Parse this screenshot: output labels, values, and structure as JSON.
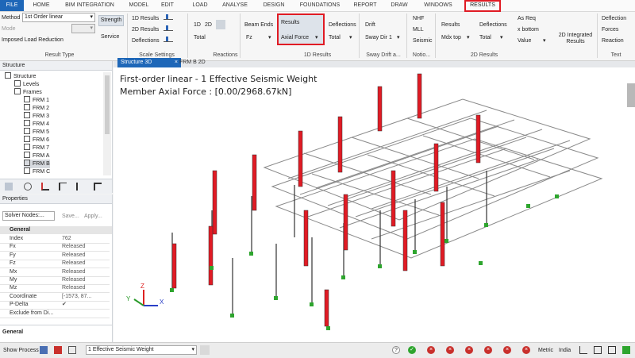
{
  "menu": {
    "items": [
      "FILE",
      "HOME",
      "BIM INTEGRATION",
      "MODEL",
      "EDIT",
      "LOAD",
      "ANALYSE",
      "DESIGN",
      "FOUNDATIONS",
      "REPORT",
      "DRAW",
      "WINDOWS",
      "RESULTS"
    ],
    "active": "RESULTS"
  },
  "ribbon": {
    "result_type": {
      "method_label": "Method",
      "method_value": "1st Order linear",
      "mode_label": "Mode",
      "imposed": "Imposed Load Reduction",
      "strength": "Strength",
      "service": "Service",
      "group": "Result Type"
    },
    "scale": {
      "r1d": "1D Results",
      "r2d": "2D Results",
      "defl": "Deflections",
      "group": "Scale Settings"
    },
    "reactions": {
      "b1d": "1D",
      "b2d": "2D",
      "total": "Total",
      "group": "Reactions"
    },
    "r1d": {
      "beam_ends": "Beam Ends",
      "fz": "Fz",
      "results": "Results",
      "axial_force": "Axial Force",
      "deflections": "Deflections",
      "total": "Total",
      "group": "1D Results"
    },
    "sway": {
      "drift": "Drift",
      "sway_dir": "Sway Dir 1",
      "group": "Sway Drift a..."
    },
    "notional": {
      "nhf": "NHF",
      "mll": "MLL",
      "seismic": "Seismic",
      "group": "Notio..."
    },
    "r2d": {
      "results": "Results",
      "mdx_top": "Mdx top",
      "deflections": "Deflections",
      "total": "Total",
      "group": "2D Results"
    },
    "r2d_int": {
      "as_req": "As Req",
      "x_bottom": "x bottom",
      "value": "Value",
      "integrated": "2D Integrated Results",
      "group": ""
    },
    "text": {
      "deflection": "Deflection",
      "forces": "Forces",
      "reaction": "Reaction",
      "group": "Text"
    }
  },
  "structure_panel": {
    "title": "Structure",
    "tree": [
      {
        "label": "Structure",
        "level": 0
      },
      {
        "label": "Levels",
        "level": 1
      },
      {
        "label": "Frames",
        "level": 1
      },
      {
        "label": "FRM 1",
        "level": 2
      },
      {
        "label": "FRM 2",
        "level": 2
      },
      {
        "label": "FRM 3",
        "level": 2
      },
      {
        "label": "FRM 4",
        "level": 2
      },
      {
        "label": "FRM 5",
        "level": 2
      },
      {
        "label": "FRM 6",
        "level": 2
      },
      {
        "label": "FRM 7",
        "level": 2
      },
      {
        "label": "FRM A",
        "level": 2
      },
      {
        "label": "FRM B",
        "level": 2,
        "selected": true
      },
      {
        "label": "FRM C",
        "level": 2
      }
    ]
  },
  "properties_panel": {
    "title": "Properties",
    "selector": "Solver Nodes:...",
    "save": "Save...",
    "apply": "Apply...",
    "section": "General",
    "rows": [
      {
        "k": "Index",
        "v": "762"
      },
      {
        "k": "Fx",
        "v": "Released"
      },
      {
        "k": "Fy",
        "v": "Released"
      },
      {
        "k": "Fz",
        "v": "Released"
      },
      {
        "k": "Mx",
        "v": "Released"
      },
      {
        "k": "My",
        "v": "Released"
      },
      {
        "k": "Mz",
        "v": "Released"
      },
      {
        "k": "Coordinate",
        "v": "[-1573, 87..."
      },
      {
        "k": "P-Delta",
        "v": "✔"
      },
      {
        "k": "Exclude from Di...",
        "v": ""
      }
    ],
    "footer": "General"
  },
  "viewport": {
    "tabs": [
      "Structure 3D",
      "FRM B 2D"
    ],
    "active_tab": "Structure 3D",
    "line1": "First-order linear - 1 Effective Seismic Weight",
    "line2": "Member Axial Force : [0.00/2968.67kN]",
    "axis": {
      "x": "X",
      "y": "Y",
      "z": "Z"
    }
  },
  "status": {
    "show_process": "Show Process",
    "loadcase": "1 Effective Seismic Weight",
    "units": "Metric",
    "region": "India"
  },
  "colors": {
    "accent": "#1e67b8",
    "highlight": "#e01b24",
    "axial": "#e01b24",
    "support": "#2ea52e"
  }
}
